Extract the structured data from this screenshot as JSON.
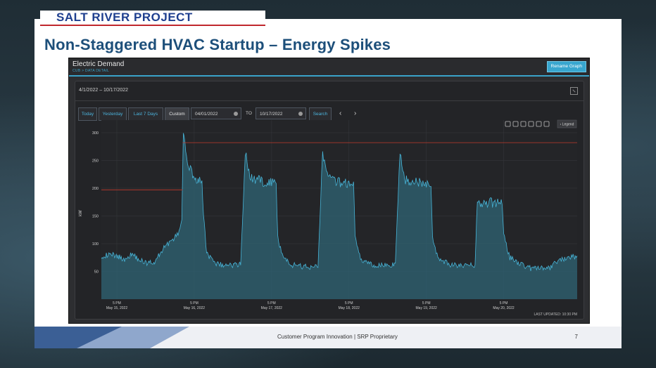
{
  "brand": {
    "name": "SALT RIVER PROJECT"
  },
  "slide": {
    "title": "Non-Staggered HVAC Startup – Energy Spikes"
  },
  "footer": {
    "text": "Customer Program Innovation | SRP Proprietary",
    "page": "7"
  },
  "app": {
    "title": "Electric Demand",
    "subtitle": "CUB > DATA DETAIL",
    "rename_button": "Rename Graph",
    "date_range": "4/1/2022 – 10/17/2022",
    "controls": {
      "today": "Today",
      "yesterday": "Yesterday",
      "last7": "Last 7 Days",
      "custom": "Custom",
      "from_value": "04/01/2022",
      "to_label": "TO",
      "to_value": "10/17/2022",
      "search": "Search",
      "prev": "‹",
      "next": "›"
    },
    "toolbar": {
      "legend": "‹ Legend",
      "icons": [
        "zoom-icon",
        "pan-icon",
        "zoom-in-icon",
        "zoom-out-icon",
        "reset-icon",
        "camera-icon"
      ]
    },
    "last_updated": "LAST UPDATED: 10:30 PM"
  },
  "colors": {
    "accent": "#3aa3c9",
    "series": "#47b3d6",
    "fill": "#2f6474",
    "threshold": "#c0392b"
  },
  "chart_data": {
    "type": "area",
    "ylabel": "kW",
    "ylim": [
      0,
      310
    ],
    "yticks": [
      50,
      100,
      150,
      200,
      250,
      300
    ],
    "xticks": [
      {
        "t": 0.0,
        "top": "5 PM",
        "bottom": "May 15, 2022"
      },
      {
        "t": 1.0,
        "top": "5 PM",
        "bottom": "May 16, 2022"
      },
      {
        "t": 2.0,
        "top": "5 PM",
        "bottom": "May 17, 2022"
      },
      {
        "t": 3.0,
        "top": "5 PM",
        "bottom": "May 18, 2022"
      },
      {
        "t": 4.0,
        "top": "5 PM",
        "bottom": "May 19, 2022"
      },
      {
        "t": 5.0,
        "top": "5 PM",
        "bottom": "May 20, 2022"
      }
    ],
    "xrange": [
      -0.2,
      5.95
    ],
    "threshold": [
      {
        "from": -0.2,
        "to": 0.85,
        "y": 197
      },
      {
        "from": 0.85,
        "to": 5.95,
        "y": 282
      }
    ],
    "series": [
      {
        "points": [
          [
            -0.2,
            78
          ],
          [
            -0.05,
            80
          ],
          [
            0.1,
            72
          ],
          [
            0.2,
            82
          ],
          [
            0.3,
            70
          ],
          [
            0.4,
            65
          ],
          [
            0.5,
            68
          ],
          [
            0.55,
            80
          ],
          [
            0.62,
            95
          ],
          [
            0.7,
            105
          ],
          [
            0.78,
            115
          ],
          [
            0.84,
            140
          ],
          [
            0.86,
            305
          ],
          [
            0.9,
            250
          ],
          [
            0.95,
            235
          ],
          [
            1.0,
            220
          ],
          [
            1.05,
            210
          ],
          [
            1.1,
            215
          ],
          [
            1.12,
            150
          ],
          [
            1.16,
            85
          ],
          [
            1.25,
            65
          ],
          [
            1.4,
            60
          ],
          [
            1.55,
            63
          ],
          [
            1.6,
            62
          ],
          [
            1.66,
            265
          ],
          [
            1.72,
            220
          ],
          [
            1.8,
            215
          ],
          [
            1.9,
            212
          ],
          [
            2.0,
            210
          ],
          [
            2.06,
            210
          ],
          [
            2.08,
            110
          ],
          [
            2.15,
            75
          ],
          [
            2.25,
            62
          ],
          [
            2.45,
            58
          ],
          [
            2.6,
            60
          ],
          [
            2.66,
            265
          ],
          [
            2.72,
            220
          ],
          [
            2.8,
            212
          ],
          [
            2.9,
            210
          ],
          [
            3.0,
            208
          ],
          [
            3.06,
            210
          ],
          [
            3.08,
            110
          ],
          [
            3.15,
            72
          ],
          [
            3.3,
            62
          ],
          [
            3.5,
            60
          ],
          [
            3.6,
            62
          ],
          [
            3.66,
            265
          ],
          [
            3.72,
            215
          ],
          [
            3.8,
            212
          ],
          [
            3.9,
            210
          ],
          [
            4.0,
            205
          ],
          [
            4.06,
            210
          ],
          [
            4.08,
            110
          ],
          [
            4.15,
            75
          ],
          [
            4.3,
            62
          ],
          [
            4.5,
            60
          ],
          [
            4.63,
            62
          ],
          [
            4.66,
            180
          ],
          [
            4.7,
            170
          ],
          [
            4.8,
            175
          ],
          [
            4.9,
            172
          ],
          [
            4.98,
            178
          ],
          [
            5.0,
            115
          ],
          [
            5.08,
            75
          ],
          [
            5.2,
            65
          ],
          [
            5.35,
            55
          ],
          [
            5.5,
            57
          ],
          [
            5.6,
            55
          ],
          [
            5.7,
            70
          ],
          [
            5.8,
            72
          ],
          [
            5.95,
            78
          ]
        ]
      }
    ]
  }
}
